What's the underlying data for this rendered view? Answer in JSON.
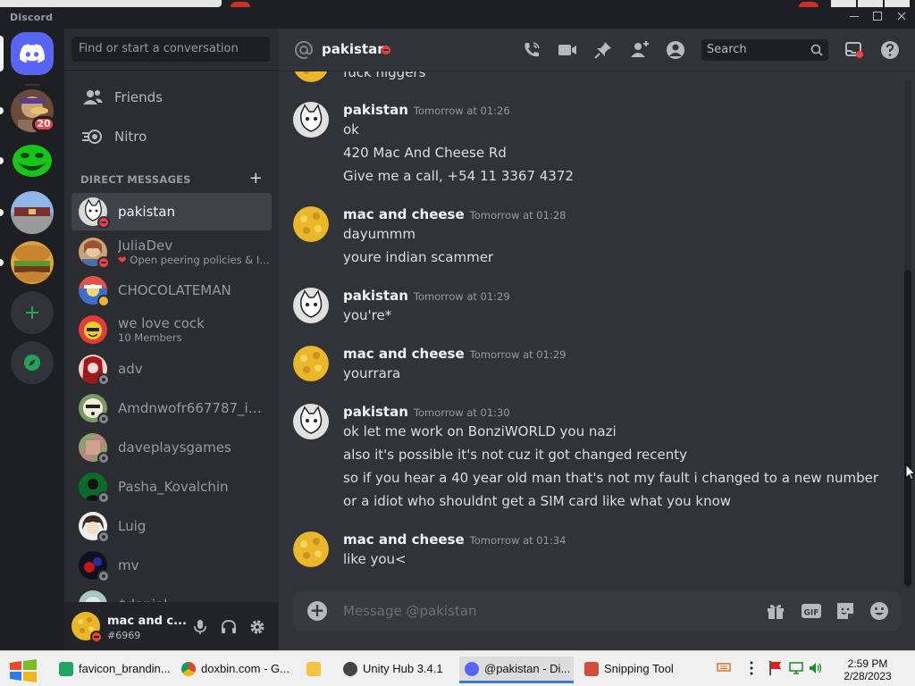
{
  "window": {
    "title": "Discord"
  },
  "rail": {
    "servers": [
      {
        "name": "server-duck",
        "badge": "20"
      },
      {
        "name": "server-trollface",
        "badge": ""
      },
      {
        "name": "server-plaza",
        "badge": ""
      },
      {
        "name": "server-burger",
        "badge": ""
      }
    ]
  },
  "sidebar": {
    "search_placeholder": "Find or start a conversation",
    "nav": [
      {
        "label": "Friends"
      },
      {
        "label": "Nitro"
      }
    ],
    "dm_header": "DIRECT MESSAGES",
    "dms": [
      {
        "name": "pakistan",
        "sub": "",
        "status": "dnd",
        "active": true
      },
      {
        "name": "JuliaDev",
        "sub": "Open peering policies & IP...",
        "status": "dnd",
        "active": false
      },
      {
        "name": "CHOCOLATEMAN",
        "sub": "",
        "status": "idle",
        "active": false
      },
      {
        "name": "we love cock",
        "sub": "10 Members",
        "status": "",
        "active": false
      },
      {
        "name": "adv",
        "sub": "",
        "status": "offline",
        "active": false
      },
      {
        "name": "Amdnwofr667787_im...",
        "sub": "",
        "status": "offline",
        "active": false
      },
      {
        "name": "daveplaysgames",
        "sub": "",
        "status": "offline",
        "active": false
      },
      {
        "name": "Pasha_Kovalchin",
        "sub": "",
        "status": "offline",
        "active": false
      },
      {
        "name": "Luig",
        "sub": "",
        "status": "offline",
        "active": false
      },
      {
        "name": "mv",
        "sub": "",
        "status": "offline",
        "active": false
      },
      {
        "name": "$daniel",
        "sub": "",
        "status": "offline",
        "active": false
      }
    ]
  },
  "user": {
    "name": "mac and c...",
    "tag": "#6969",
    "status": "dnd"
  },
  "channel": {
    "name": "pakistan",
    "status": "dnd",
    "search_placeholder": "Search"
  },
  "messages": {
    "partial_line": "fuck niggers",
    "groups": [
      {
        "author": "pakistan",
        "timestamp": "Tomorrow at 01:26",
        "lines": [
          "ok",
          "420 Mac And Cheese Rd",
          "Give me a call, +54 11 3367 4372"
        ]
      },
      {
        "author": "mac and cheese",
        "timestamp": "Tomorrow at 01:28",
        "lines": [
          "dayummm",
          "youre indian scammer"
        ]
      },
      {
        "author": "pakistan",
        "timestamp": "Tomorrow at 01:29",
        "lines": [
          "you're*"
        ]
      },
      {
        "author": "mac and cheese",
        "timestamp": "Tomorrow at 01:29",
        "lines": [
          "yourrara"
        ]
      },
      {
        "author": "pakistan",
        "timestamp": "Tomorrow at 01:30",
        "lines": [
          "ok let me work on BonziWORLD you nazi",
          "also it's possible it's not cuz it got changed recenty",
          "so if you hear a 40 year old man that's not my fault i changed to a new number",
          "or a idiot who shouldnt get a SIM card like what you know"
        ]
      },
      {
        "author": "mac and cheese",
        "timestamp": "Tomorrow at 01:34",
        "lines": [
          "like you<"
        ]
      }
    ]
  },
  "composer": {
    "placeholder": "Message @pakistan",
    "gif_label": "GIF"
  },
  "taskbar": {
    "items": [
      {
        "label": "favicon_brandin...",
        "active": false
      },
      {
        "label": "doxbin.com - G...",
        "active": false
      },
      {
        "label": "",
        "active": false
      },
      {
        "label": "Unity Hub 3.4.1",
        "active": false
      },
      {
        "label": "@pakistan - Di...",
        "active": true
      },
      {
        "label": "Snipping Tool",
        "active": false
      }
    ],
    "time": "2:59 PM",
    "date": "2/28/2023"
  },
  "colors": {
    "blurple": "#5865f2",
    "dnd": "#f23f43",
    "idle": "#f0b232",
    "offline": "#80848e",
    "green": "#23a559"
  }
}
